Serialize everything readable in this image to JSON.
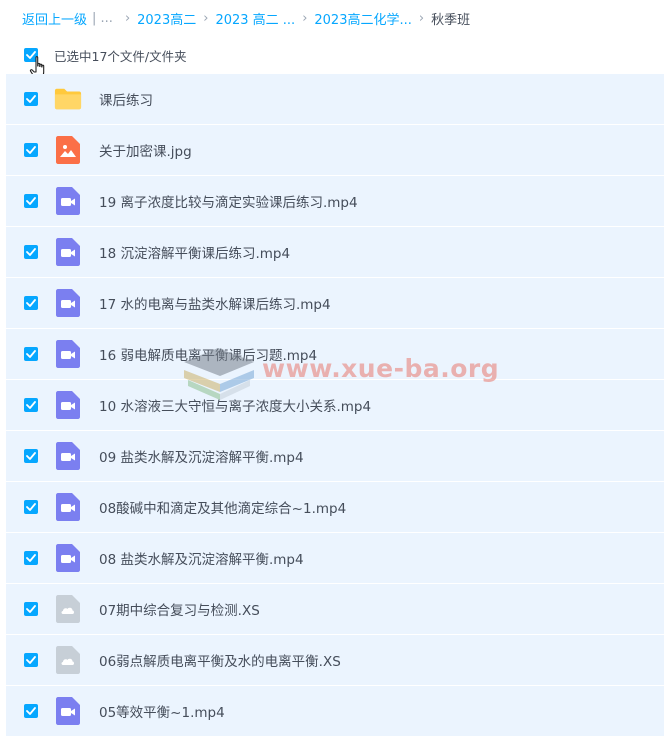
{
  "breadcrumb": {
    "back_label": "返回上一级",
    "sep_label": "| ...",
    "items": [
      "2023高二",
      "2023 高二 ...",
      "2023高二化学..."
    ],
    "current": "秋季班"
  },
  "selection": {
    "text": "已选中17个文件/文件夹",
    "checked": true
  },
  "files": [
    {
      "name": "课后练习",
      "type": "folder"
    },
    {
      "name": "关于加密课.jpg",
      "type": "image"
    },
    {
      "name": "19 离子浓度比较与滴定实验课后练习.mp4",
      "type": "video"
    },
    {
      "name": "18 沉淀溶解平衡课后练习.mp4",
      "type": "video"
    },
    {
      "name": "17 水的电离与盐类水解课后练习.mp4",
      "type": "video"
    },
    {
      "name": "16 弱电解质电离平衡课后习题.mp4",
      "type": "video"
    },
    {
      "name": "10 水溶液三大守恒与离子浓度大小关系.mp4",
      "type": "video"
    },
    {
      "name": "09 盐类水解及沉淀溶解平衡.mp4",
      "type": "video"
    },
    {
      "name": "08酸碱中和滴定及其他滴定综合~1.mp4",
      "type": "video"
    },
    {
      "name": "08 盐类水解及沉淀溶解平衡.mp4",
      "type": "video"
    },
    {
      "name": "07期中综合复习与检测.XS",
      "type": "cloud"
    },
    {
      "name": "06弱点解质电离平衡及水的电离平衡.XS",
      "type": "cloud"
    },
    {
      "name": "05等效平衡~1.mp4",
      "type": "video"
    }
  ],
  "watermark": {
    "text": "www.xue-ba.org"
  },
  "colors": {
    "accent": "#06a7ff",
    "row_bg": "#ebf4fe",
    "text": "#454d5a",
    "folder": "#ffc93c",
    "image": "#fb6f47",
    "video": "#7b7ff0",
    "cloud": "#c7cfd7"
  },
  "icons": {
    "folder": "folder-icon",
    "image": "image-file-icon",
    "video": "video-file-icon",
    "cloud": "cloud-file-icon",
    "check": "checkmark-icon",
    "cursor": "hand-pointer-icon"
  }
}
